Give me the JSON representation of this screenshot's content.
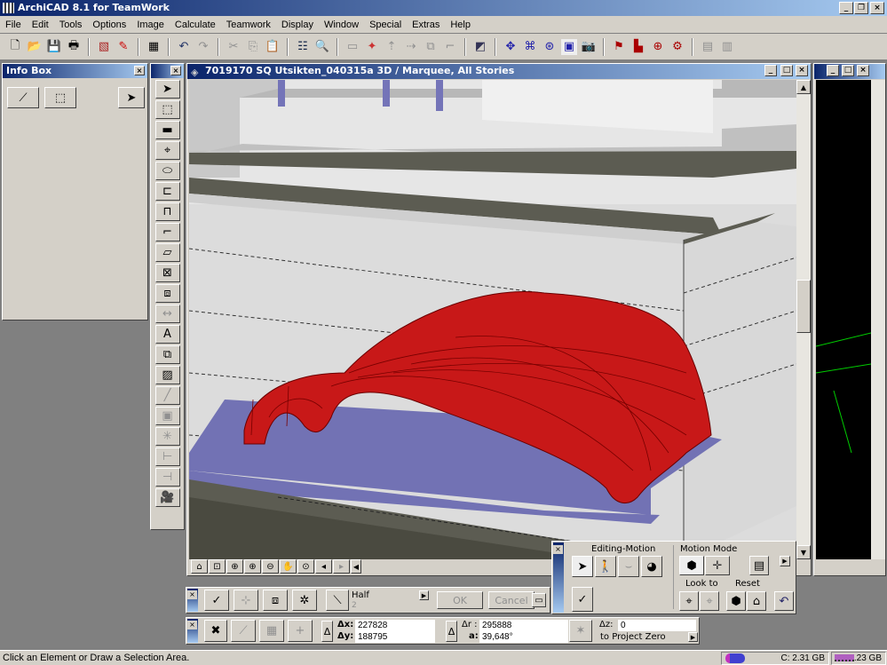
{
  "app": {
    "title": "ArchiCAD 8.1 for TeamWork"
  },
  "menu": [
    "File",
    "Edit",
    "Tools",
    "Options",
    "Image",
    "Calculate",
    "Teamwork",
    "Display",
    "Window",
    "Special",
    "Extras",
    "Help"
  ],
  "toolbar_icons": [
    "new-icon",
    "open-icon",
    "save-icon",
    "print-icon",
    "plotmaker-icon",
    "publish-icon",
    "teamwork-icon",
    "undo-icon",
    "redo-icon",
    "cut-icon",
    "copy-icon",
    "paste-icon",
    "layers-icon",
    "find-icon",
    "group-icon",
    "trim-icon",
    "elevate-icon",
    "drag-icon",
    "multiply-icon",
    "corner-icon",
    "3d-view-icon",
    "navigator-icon",
    "camera-icon",
    "render-icon",
    "library-icon",
    "zoom-icon",
    "settings-icon",
    "window-icon"
  ],
  "info_box": {
    "title": "Info Box"
  },
  "window3d": {
    "title": "7019170 SQ Utsikten_040315a 3D / Marquee, All Stories"
  },
  "control_box": {
    "line_type": "Half",
    "line_sub": "2",
    "ok": "OK",
    "cancel": "Cancel"
  },
  "coords": {
    "dx_label": "Δx:",
    "dx": "227828",
    "dy_label": "Δy:",
    "dy": "188795",
    "dr_label": "Δr :",
    "dr": "295888",
    "a_label": "a:",
    "a": "39,648°",
    "dz_label": "Δz:",
    "dz": "0",
    "ref": "to Project Zero"
  },
  "navigator": {
    "editing_motion": "Editing-Motion",
    "motion_mode": "Motion Mode",
    "look_to": "Look to",
    "reset": "Reset"
  },
  "status": {
    "message": "Click an Element or Draw a Selection Area.",
    "disk": "C: 2.31 GB",
    "memory": "1.23 GB"
  },
  "colors": {
    "title_blue": "#0a246a",
    "marquee_red": "#c81818",
    "floor_blue": "#7272b4",
    "slab": "#5c5c52",
    "wall": "#dcdcdc"
  }
}
